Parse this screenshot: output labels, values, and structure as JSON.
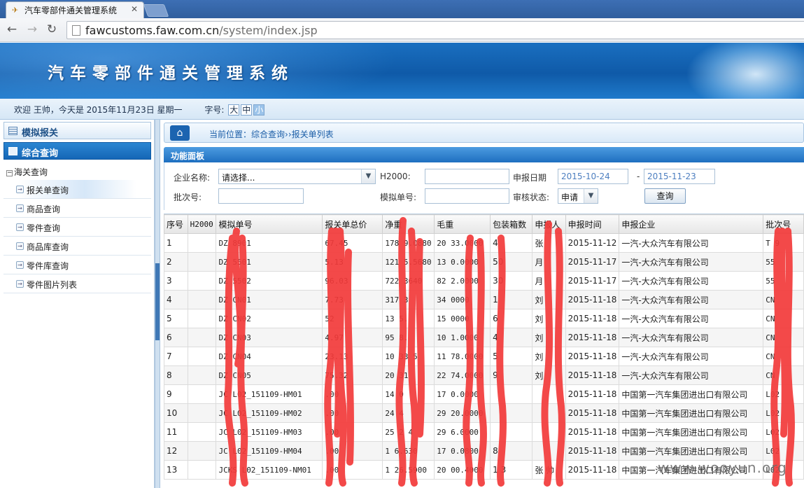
{
  "browser": {
    "tab_title": "汽车零部件通关管理系统",
    "url_host": "fawcustoms.faw.com.cn",
    "url_path": "/system/index.jsp"
  },
  "app": {
    "banner_title": "汽车零部件通关管理系统",
    "welcome": "欢迎 王帅，今天是 2015年11月23日 星期一",
    "font_size_label": "字号:",
    "font_sizes": [
      "大",
      "中",
      "小"
    ],
    "font_size_selected": "小"
  },
  "sidebar": {
    "section1": "模拟报关",
    "section2": "综合查询",
    "tree_root": "海关查询",
    "items": [
      "报关单查询",
      "商品查询",
      "零件查询",
      "商品库查询",
      "零件库查询",
      "零件图片列表"
    ],
    "active_item": "报关单查询"
  },
  "breadcrumb": {
    "prefix": "当前位置：",
    "level1": "综合查询",
    "sep": "››",
    "level2": "报关单列表"
  },
  "panel": {
    "title": "功能面板",
    "company_label": "企业名称:",
    "company_value": "请选择...",
    "h2000_label": "H2000:",
    "h2000_value": "",
    "date_label": "申报日期",
    "date_from": "2015-10-24",
    "date_sep": "-",
    "date_to": "2015-11-23",
    "batch_label": "批次号:",
    "batch_value": "",
    "sim_no_label": "模拟单号:",
    "sim_no_value": "",
    "status_label": "审核状态:",
    "status_value": "申请",
    "query_button": "查询"
  },
  "table": {
    "headers": [
      "序号",
      "H2000",
      "模拟单号",
      "报关单总价",
      "净重",
      "毛重",
      "包装箱数",
      "申报人",
      "申报时间",
      "申报企业",
      "批次号"
    ],
    "rows": [
      [
        "1",
        "",
        "DZ 8901",
        "67.45",
        "178 9.0880",
        "20 33.0000",
        "4",
        "张 ",
        "2015-11-12",
        "一汽-大众汽车有限公司",
        "T 9"
      ],
      [
        "2",
        "",
        "DZ 5501",
        "5.13",
        "121 5.5680",
        "13 0.0000",
        "50",
        "月",
        "2015-11-17",
        "一汽-大众汽车有限公司",
        "55"
      ],
      [
        "3",
        "",
        "DZ 5502",
        "96.03",
        "722 3640",
        "82 2.0000",
        "30",
        "月",
        "2015-11-17",
        "一汽-大众汽车有限公司",
        "55"
      ],
      [
        "4",
        "",
        "DZ CN01",
        "7.73",
        "317 3",
        "34 0000",
        "1",
        "刘",
        "2015-11-18",
        "一汽-大众汽车有限公司",
        "CN"
      ],
      [
        "5",
        "",
        "DZ CN02",
        "52",
        "13 5.",
        "15 0000",
        "6",
        "刘",
        "2015-11-18",
        "一汽-大众汽车有限公司",
        "CN"
      ],
      [
        "6",
        "",
        "DZ CN03",
        "4.97",
        "95 8.",
        "10 1.0000",
        "4",
        "刘",
        "2015-11-18",
        "一汽-大众汽车有限公司",
        "CN"
      ],
      [
        "7",
        "",
        "DZ CN04",
        "23.13",
        "10 33 5",
        "11 78.0000",
        "5",
        "刘",
        "2015-11-18",
        "一汽-大众汽车有限公司",
        "CN"
      ],
      [
        "8",
        "",
        "DZ CN05",
        "75.32",
        "20 31",
        "22 74.0000",
        "9",
        "刘",
        "2015-11-18",
        "一汽-大众汽车有限公司",
        "CN"
      ],
      [
        "9",
        "",
        "JC L02_151109-HM01",
        ".00",
        "14 0",
        "17 0.0000",
        "",
        "",
        "2015-11-18",
        "中国第一汽车集团进出口有限公司",
        "L02"
      ],
      [
        "10",
        "",
        "JC L02_151109-HM02",
        ".00",
        "24 4",
        "29 20.0000",
        "",
        "",
        "2015-11-18",
        "中国第一汽车集团进出口有限公司",
        "L02"
      ],
      [
        "11",
        "",
        "JC L02_151109-HM03",
        ".00",
        "25 2 4",
        "29 6.0000",
        "",
        "",
        "2015-11-18",
        "中国第一汽车集团进出口有限公司",
        "L02"
      ],
      [
        "12",
        "",
        "JC L02_151109-HM04",
        ".00",
        "1 6.630",
        "17 0.0800",
        "8",
        "",
        "2015-11-18",
        "中国第一汽车集团进出口有限公司",
        "L02"
      ],
      [
        "13",
        "",
        "JCKS L02_151109-NM01",
        ".00",
        "1 26.5900",
        "20 00.4000",
        "1 3",
        "张 帅",
        "2015-11-18",
        "中国第一汽车集团进出口有限公司",
        "L02"
      ]
    ]
  },
  "watermark": "www.wooyun.org",
  "colors": {
    "brand_blue": "#1566b6",
    "redaction_red": "#f23a3a",
    "link_blue": "#1c5fa8"
  }
}
